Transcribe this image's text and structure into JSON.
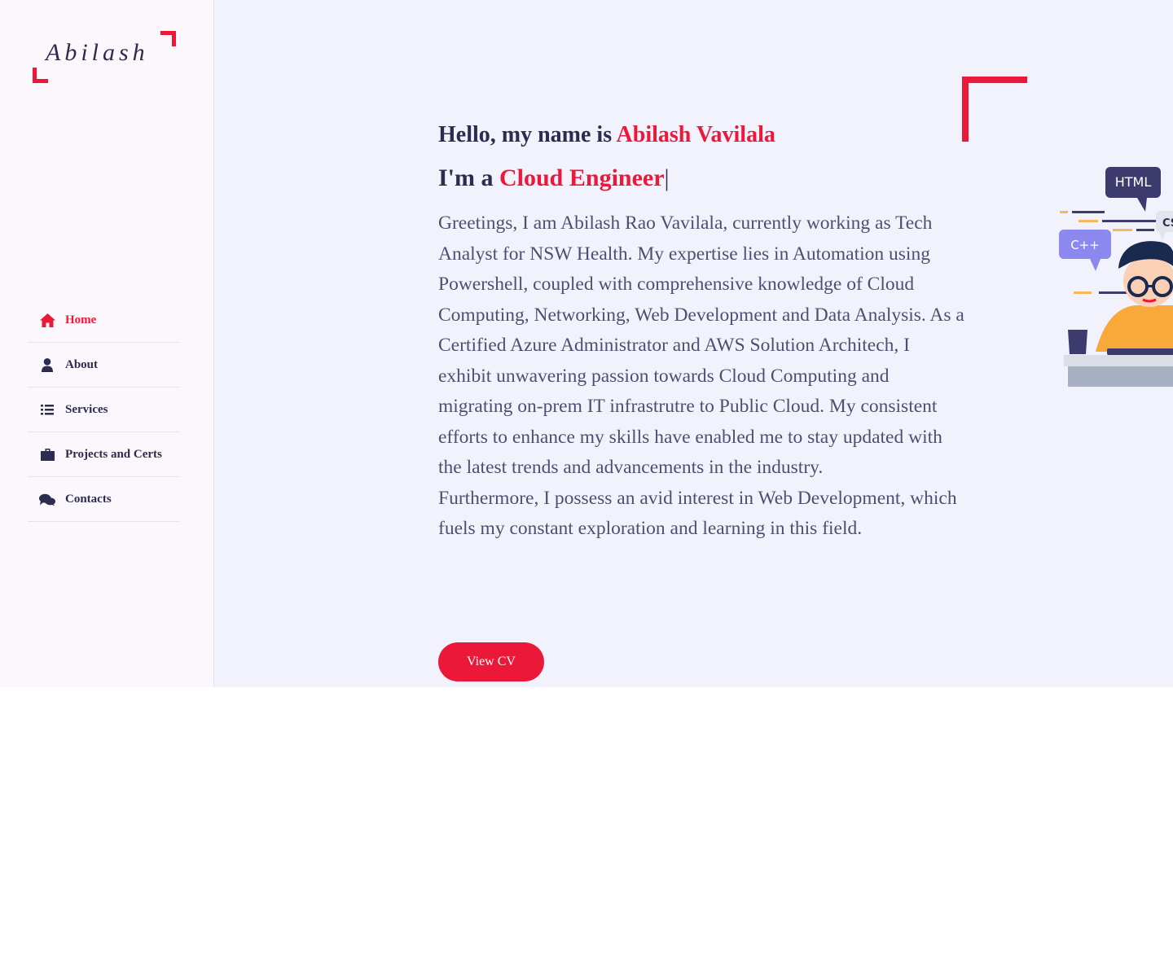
{
  "logo": {
    "text": "Abilash"
  },
  "nav": [
    {
      "label": "Home",
      "icon": "home-icon",
      "active": true
    },
    {
      "label": "About",
      "icon": "user-icon",
      "active": false
    },
    {
      "label": "Services",
      "icon": "list-icon",
      "active": false
    },
    {
      "label": "Projects and Certs",
      "icon": "briefcase-icon",
      "active": false
    },
    {
      "label": "Contacts",
      "icon": "comments-icon",
      "active": false
    }
  ],
  "hero": {
    "greeting_prefix": "Hello, my name is ",
    "name": "Abilash Vavilala",
    "role_prefix": "I'm a ",
    "role": "Cloud Engineer",
    "cursor": "|",
    "description_1": "Greetings, I am Abilash Rao Vavilala, currently working as Tech Analyst for NSW Health. My expertise lies in Automation using Powershell, coupled with comprehensive knowledge of Cloud Computing, Networking, Web Development and Data Analysis. As a Certified Azure Administrator and AWS Solution Architech, I exhibit unwavering passion towards Cloud Computing and migrating on-prem IT infrastrutre to Public Cloud. My consistent efforts to enhance my skills have enabled me to stay updated with the latest trends and advancements in the industry.",
    "description_2": "Furthermore, I possess an avid interest in Web Development, which fuels my constant exploration and learning in this field.",
    "cv_button": "View CV"
  },
  "illustration": {
    "bubble_html": "HTML",
    "bubble_cpp": "C++",
    "bubble_css": "CS"
  },
  "colors": {
    "accent": "#ec1839",
    "text_dark": "#2b2c4e",
    "text_body": "#504e70",
    "main_bg": "#f2f2fc",
    "sidebar_bg": "#fbf7fc"
  }
}
